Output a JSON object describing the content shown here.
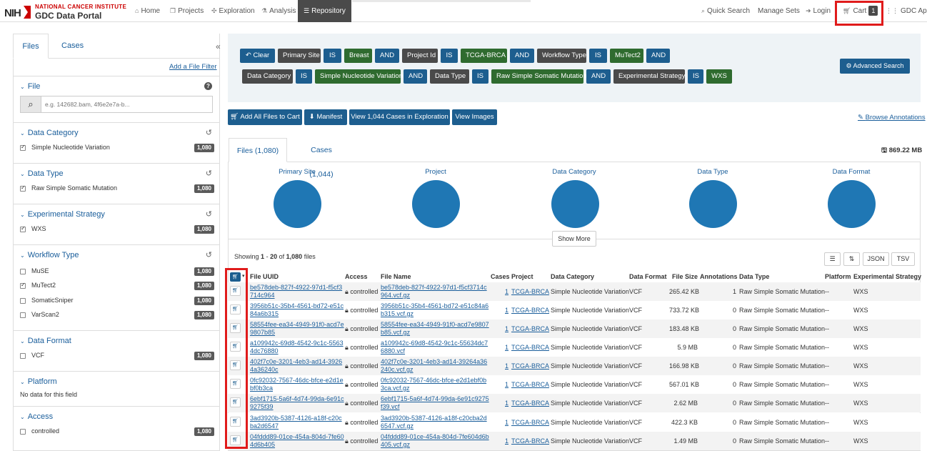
{
  "navbar": {
    "logo_nih": "NIH",
    "logo_nci": "NATIONAL CANCER INSTITUTE",
    "logo_gdc": "GDC Data Portal",
    "home": "Home",
    "projects": "Projects",
    "exploration": "Exploration",
    "analysis": "Analysis",
    "repository": "Repository",
    "quick_search": "Quick Search",
    "manage_sets": "Manage Sets",
    "login": "Login",
    "cart": "Cart",
    "cart_count": "1",
    "gdc_apps": "GDC Apps"
  },
  "sidebar": {
    "tab_files": "Files",
    "tab_cases": "Cases",
    "add_filter": "Add a File Filter",
    "file_title": "File",
    "file_placeholder": "e.g. 142682.bam, 4f6e2e7a-b...",
    "facets": [
      {
        "title": "Data Category",
        "items": [
          {
            "label": "Simple Nucleotide Variation",
            "count": "1,080",
            "checked": true
          }
        ]
      },
      {
        "title": "Data Type",
        "items": [
          {
            "label": "Raw Simple Somatic Mutation",
            "count": "1,080",
            "checked": true
          }
        ]
      },
      {
        "title": "Experimental Strategy",
        "items": [
          {
            "label": "WXS",
            "count": "1,080",
            "checked": true
          }
        ]
      },
      {
        "title": "Workflow Type",
        "items": [
          {
            "label": "MuSE",
            "count": "1,080",
            "checked": false
          },
          {
            "label": "MuTect2",
            "count": "1,080",
            "checked": true
          },
          {
            "label": "SomaticSniper",
            "count": "1,080",
            "checked": false
          },
          {
            "label": "VarScan2",
            "count": "1,080",
            "checked": false
          }
        ]
      },
      {
        "title": "Data Format",
        "items": [
          {
            "label": "VCF",
            "count": "1,080",
            "checked": false
          }
        ]
      },
      {
        "title": "Platform",
        "no_data": "No data for this field"
      },
      {
        "title": "Access",
        "items": [
          {
            "label": "controlled",
            "count": "1,080",
            "checked": false
          }
        ]
      }
    ]
  },
  "query": {
    "clear": "Clear",
    "row1": [
      "Primary Site",
      "IS",
      "Breast",
      "AND",
      "Project Id",
      "IS",
      "TCGA-BRCA",
      "AND",
      "Workflow Type",
      "IS",
      "MuTect2",
      "AND"
    ],
    "row2": [
      "Data Category",
      "IS",
      "Simple Nucleotide Variation",
      "AND",
      "Data Type",
      "IS",
      "Raw Simple Somatic Mutation",
      "AND",
      "Experimental Strategy",
      "IS",
      "WXS"
    ],
    "advanced_search": "Advanced Search"
  },
  "actions": {
    "add_all": "Add All Files to Cart",
    "manifest": "Manifest",
    "view_cases": "View 1,044 Cases in Exploration",
    "view_images": "View Images",
    "browse_annotations": "Browse Annotations"
  },
  "tabs": {
    "files": "Files (1,080)",
    "cases": "Cases (1,044)",
    "total_size": "869.22 MB"
  },
  "charts": {
    "titles": [
      "Primary Site",
      "Project",
      "Data Category",
      "Data Type",
      "Data Format"
    ],
    "show_more": "Show More"
  },
  "table_info": {
    "showing_prefix": "Showing",
    "start": "1",
    "dash": "-",
    "end": "20",
    "of": "of",
    "total": "1,080",
    "suffix": "files",
    "json": "JSON",
    "tsv": "TSV"
  },
  "table": {
    "headers": [
      "File UUID",
      "Access",
      "File Name",
      "Cases",
      "Project",
      "Data Category",
      "Data Format",
      "File Size",
      "Annotations",
      "Data Type",
      "Platform",
      "Experimental Strategy"
    ],
    "rows": [
      {
        "uuid": "be578deb-827f-4922-97d1-f5cf3714c964",
        "access": "controlled",
        "name": "be578deb-827f-4922-97d1-f5cf3714c964.vcf.gz",
        "cases": "1",
        "project": "TCGA-BRCA",
        "category": "Simple Nucleotide Variation",
        "format": "VCF",
        "size": "265.42 KB",
        "annotations": "1",
        "type": "Raw Simple Somatic Mutation",
        "platform": "--",
        "strategy": "WXS"
      },
      {
        "uuid": "3956b51c-35b4-4561-bd72-e51c84a6b315",
        "access": "controlled",
        "name": "3956b51c-35b4-4561-bd72-e51c84a6b315.vcf.gz",
        "cases": "1",
        "project": "TCGA-BRCA",
        "category": "Simple Nucleotide Variation",
        "format": "VCF",
        "size": "733.72 KB",
        "annotations": "0",
        "type": "Raw Simple Somatic Mutation",
        "platform": "--",
        "strategy": "WXS"
      },
      {
        "uuid": "58554fee-ea34-4949-91f0-acd7e9807b85",
        "access": "controlled",
        "name": "58554fee-ea34-4949-91f0-acd7e9807b85.vcf.gz",
        "cases": "1",
        "project": "TCGA-BRCA",
        "category": "Simple Nucleotide Variation",
        "format": "VCF",
        "size": "183.48 KB",
        "annotations": "0",
        "type": "Raw Simple Somatic Mutation",
        "platform": "--",
        "strategy": "WXS"
      },
      {
        "uuid": "a109942c-69d8-4542-9c1c-55634dc76880",
        "access": "controlled",
        "name": "a109942c-69d8-4542-9c1c-55634dc76880.vcf",
        "cases": "1",
        "project": "TCGA-BRCA",
        "category": "Simple Nucleotide Variation",
        "format": "VCF",
        "size": "5.9 MB",
        "annotations": "0",
        "type": "Raw Simple Somatic Mutation",
        "platform": "--",
        "strategy": "WXS"
      },
      {
        "uuid": "402f7c0e-3201-4eb3-ad14-39264a36240c",
        "access": "controlled",
        "name": "402f7c0e-3201-4eb3-ad14-39264a36240c.vcf.gz",
        "cases": "1",
        "project": "TCGA-BRCA",
        "category": "Simple Nucleotide Variation",
        "format": "VCF",
        "size": "166.98 KB",
        "annotations": "0",
        "type": "Raw Simple Somatic Mutation",
        "platform": "--",
        "strategy": "WXS"
      },
      {
        "uuid": "0fc92032-7567-46dc-bfce-e2d1ebf0b3ca",
        "access": "controlled",
        "name": "0fc92032-7567-46dc-bfce-e2d1ebf0b3ca.vcf.gz",
        "cases": "1",
        "project": "TCGA-BRCA",
        "category": "Simple Nucleotide Variation",
        "format": "VCF",
        "size": "567.01 KB",
        "annotations": "0",
        "type": "Raw Simple Somatic Mutation",
        "platform": "--",
        "strategy": "WXS"
      },
      {
        "uuid": "6ebf1715-5a6f-4d74-99da-6e91c9275f39",
        "access": "controlled",
        "name": "6ebf1715-5a6f-4d74-99da-6e91c9275f39.vcf",
        "cases": "1",
        "project": "TCGA-BRCA",
        "category": "Simple Nucleotide Variation",
        "format": "VCF",
        "size": "2.62 MB",
        "annotations": "0",
        "type": "Raw Simple Somatic Mutation",
        "platform": "--",
        "strategy": "WXS"
      },
      {
        "uuid": "3ad3920b-5387-4126-a18f-c20cba2d6547",
        "access": "controlled",
        "name": "3ad3920b-5387-4126-a18f-c20cba2d6547.vcf.gz",
        "cases": "1",
        "project": "TCGA-BRCA",
        "category": "Simple Nucleotide Variation",
        "format": "VCF",
        "size": "422.3 KB",
        "annotations": "0",
        "type": "Raw Simple Somatic Mutation",
        "platform": "--",
        "strategy": "WXS"
      },
      {
        "uuid": "04fddd89-01ce-454a-804d-7fe604d6b405",
        "access": "controlled",
        "name": "04fddd89-01ce-454a-804d-7fe604d6b405.vcf.gz",
        "cases": "1",
        "project": "TCGA-BRCA",
        "category": "Simple Nucleotide Variation",
        "format": "VCF",
        "size": "1.49 MB",
        "annotations": "0",
        "type": "Raw Simple Somatic Mutation",
        "platform": "--",
        "strategy": "WXS"
      }
    ]
  },
  "colors": {
    "primary": "#1d5e8f",
    "link": "#1a5e9b",
    "field_pill": "#4a4a4a",
    "value_pill": "#2f6b2f",
    "pie": "#1f77b4",
    "highlight": "#e01b1b"
  }
}
